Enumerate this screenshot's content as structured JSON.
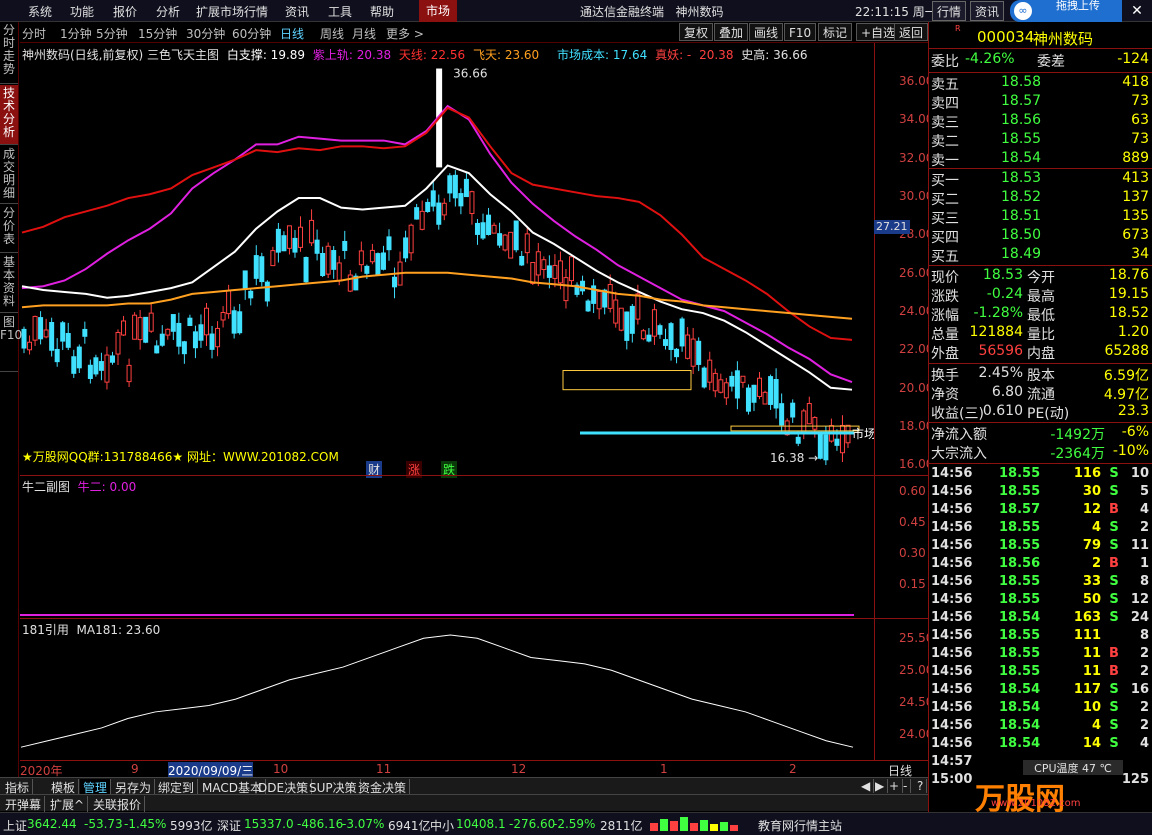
{
  "menu": [
    "系统",
    "功能",
    "报价",
    "分析",
    "扩展市场行情",
    "资讯",
    "工具",
    "帮助"
  ],
  "market_tab": "市场",
  "window_title": "通达信金融终端",
  "window_stock": "神州数码",
  "clock": "22:11:15 周一",
  "top_right_tabs": [
    "行情",
    "资讯"
  ],
  "upload_label": "拖拽上传",
  "left_tabs": [
    "分时走势",
    "技术分析",
    "成交明细",
    "分价表",
    "基本资料",
    "图F10"
  ],
  "periods": [
    "分时",
    "1分钟",
    "5分钟",
    "15分钟",
    "30分钟",
    "60分钟",
    "日线",
    "周线",
    "月线",
    "更多 >"
  ],
  "period_selected": "日线",
  "chart_buttons": [
    "复权",
    "叠加",
    "画线",
    "F10",
    "标记",
    "+自选",
    "返回"
  ],
  "legend": {
    "title": "神州数码(日线,前复权) 三色飞天主图",
    "white": "白支撑: 19.89",
    "purple": "紫上轨: 20.38",
    "red": "天线: 22.56",
    "fly": "飞天: 23.60",
    "cost": "市场成本: 17.64",
    "true": "真妖: -",
    "v2038": "20.38",
    "hist": "史高: 36.66"
  },
  "main_y": [
    "36.00",
    "34.00",
    "32.00",
    "30.00",
    "28.00",
    "26.00",
    "24.00",
    "22.00",
    "20.00",
    "18.00",
    "16.00"
  ],
  "price_tag": "27.21",
  "high_label": "36.66",
  "low_label": "16.38",
  "market_label": "市场",
  "ad_text": "★万股网QQ群:131788466★ 网址：WWW.201082.COM",
  "tags": [
    "财",
    "涨",
    "跌"
  ],
  "sub1": {
    "name": "牛二副图",
    "field": "牛二: 0.00",
    "y": [
      "0.60",
      "0.45",
      "0.30",
      "0.15"
    ]
  },
  "sub2": {
    "name": "181引用",
    "field": "MA181: 23.60",
    "y": [
      "25.50",
      "25.00",
      "24.50",
      "24.00"
    ]
  },
  "x_labels": [
    "2020年",
    "9",
    "2020/09/09/三",
    "10",
    "11",
    "12",
    "1",
    "2"
  ],
  "x_right": "日线",
  "bottom_tabs": [
    "指标",
    "模板",
    "管理",
    "另存为",
    "绑定到",
    "MACD基本",
    "DDE决策",
    "SUP决策",
    "资金决策"
  ],
  "bottom_sel": "管理",
  "bottom_tabs2": [
    "开弹幕",
    "扩展^",
    "关联报价"
  ],
  "status": {
    "sh_label": "上证",
    "sh_val": "3642.44",
    "sh_chg": "-53.73",
    "sh_pct": "-1.45%",
    "sh_amt": "5993亿",
    "sz_label": "深证",
    "sz_val": "15337.0",
    "sz_chg": "-486.16",
    "sz_pct": "-3.07%",
    "sz_amt": "6941亿",
    "zx_label": "中小",
    "zx_val": "10408.1",
    "zx_chg": "-276.60",
    "zx_pct": "-2.59%",
    "zx_amt": "2811亿",
    "site": "教育网行情主站"
  },
  "stock": {
    "code": "000034",
    "name": "神州数码"
  },
  "quote": {
    "weibi_label": "委比",
    "weibi": "-4.26%",
    "weicha_label": "委差",
    "weicha": "-124"
  },
  "asks": [
    {
      "l": "卖五",
      "p": "18.58",
      "v": "418"
    },
    {
      "l": "卖四",
      "p": "18.57",
      "v": "73"
    },
    {
      "l": "卖三",
      "p": "18.56",
      "v": "63"
    },
    {
      "l": "卖二",
      "p": "18.55",
      "v": "73"
    },
    {
      "l": "卖一",
      "p": "18.54",
      "v": "889"
    }
  ],
  "bids": [
    {
      "l": "买一",
      "p": "18.53",
      "v": "413"
    },
    {
      "l": "买二",
      "p": "18.52",
      "v": "137"
    },
    {
      "l": "买三",
      "p": "18.51",
      "v": "135"
    },
    {
      "l": "买四",
      "p": "18.50",
      "v": "673"
    },
    {
      "l": "买五",
      "p": "18.49",
      "v": "34"
    }
  ],
  "stats1": [
    {
      "l": "现价",
      "v": "18.53",
      "c": "down",
      "l2": "今开",
      "v2": "18.76",
      "c2": "up"
    },
    {
      "l": "涨跌",
      "v": "-0.24",
      "c": "down",
      "l2": "最高",
      "v2": "19.15",
      "c2": "up"
    },
    {
      "l": "涨幅",
      "v": "-1.28%",
      "c": "down",
      "l2": "最低",
      "v2": "18.52",
      "c2": "down"
    },
    {
      "l": "总量",
      "v": "121884",
      "c": "yellow",
      "l2": "量比",
      "v2": "1.20",
      "c2": "up"
    },
    {
      "l": "外盘",
      "v": "56596",
      "c": "up",
      "l2": "内盘",
      "v2": "65288",
      "c2": "down"
    }
  ],
  "stats2": [
    {
      "l": "换手",
      "v": "2.45%",
      "l2": "股本",
      "v2": "6.59亿"
    },
    {
      "l": "净资",
      "v": "6.80",
      "l2": "流通",
      "v2": "4.97亿"
    },
    {
      "l": "收益(三)",
      "v": "0.610",
      "l2": "PE(动)",
      "v2": "23.3"
    }
  ],
  "flow": [
    {
      "l": "净流入额",
      "v": "-1492万",
      "p": "-6%"
    },
    {
      "l": "大宗流入",
      "v": "-2364万",
      "p": "-10%"
    }
  ],
  "ticks": [
    {
      "t": "14:56",
      "p": "18.55",
      "v": "116",
      "d": "S",
      "n": "10"
    },
    {
      "t": "14:56",
      "p": "18.55",
      "v": "30",
      "d": "S",
      "n": "5"
    },
    {
      "t": "14:56",
      "p": "18.57",
      "v": "12",
      "d": "B",
      "n": "4"
    },
    {
      "t": "14:56",
      "p": "18.55",
      "v": "4",
      "d": "S",
      "n": "2"
    },
    {
      "t": "14:56",
      "p": "18.55",
      "v": "79",
      "d": "S",
      "n": "11"
    },
    {
      "t": "14:56",
      "p": "18.56",
      "v": "2",
      "d": "B",
      "n": "1"
    },
    {
      "t": "14:56",
      "p": "18.55",
      "v": "33",
      "d": "S",
      "n": "8"
    },
    {
      "t": "14:56",
      "p": "18.55",
      "v": "50",
      "d": "S",
      "n": "12"
    },
    {
      "t": "14:56",
      "p": "18.54",
      "v": "163",
      "d": "S",
      "n": "24"
    },
    {
      "t": "14:56",
      "p": "18.55",
      "v": "111",
      "d": "",
      "n": "8"
    },
    {
      "t": "14:56",
      "p": "18.55",
      "v": "11",
      "d": "B",
      "n": "2"
    },
    {
      "t": "14:56",
      "p": "18.55",
      "v": "11",
      "d": "B",
      "n": "2"
    },
    {
      "t": "14:56",
      "p": "18.54",
      "v": "117",
      "d": "S",
      "n": "16"
    },
    {
      "t": "14:56",
      "p": "18.54",
      "v": "10",
      "d": "S",
      "n": "2"
    },
    {
      "t": "14:56",
      "p": "18.54",
      "v": "4",
      "d": "S",
      "n": "2"
    },
    {
      "t": "14:56",
      "p": "18.54",
      "v": "14",
      "d": "S",
      "n": "4"
    },
    {
      "t": "14:57",
      "p": "",
      "v": "",
      "d": "",
      "n": ""
    },
    {
      "t": "15:00",
      "p": "",
      "v": "",
      "d": "",
      "n": "125"
    }
  ],
  "cpu_label": "CPU温度 47 ℃",
  "watermark": "万股网",
  "watermark_url": "www.201082.com",
  "chart_data": {
    "type": "line",
    "series": [
      {
        "name": "紫上轨",
        "color": "#e020e0",
        "values": [
          25.2,
          25.3,
          25.6,
          26.2,
          27.0,
          27.7,
          28.3,
          29.1,
          30.4,
          31.2,
          31.9,
          32.7,
          32.7,
          33.1,
          33.0,
          32.9,
          32.9,
          32.9,
          32.7,
          33.4,
          34.7,
          34.0,
          32.2,
          30.7,
          29.6,
          28.7,
          27.9,
          27.2,
          26.4,
          25.8,
          25.2,
          24.6,
          24.3,
          24.0,
          23.4,
          22.8,
          22.1,
          21.5,
          20.7,
          20.3
        ]
      },
      {
        "name": "天线",
        "color": "#e01010",
        "values": [
          28.1,
          28.4,
          28.9,
          29.2,
          29.5,
          29.9,
          30.1,
          30.4,
          31.1,
          31.5,
          31.9,
          32.4,
          32.3,
          32.5,
          32.4,
          32.6,
          32.6,
          32.5,
          32.6,
          33.3,
          34.6,
          34.1,
          32.6,
          31.2,
          30.6,
          30.4,
          30.2,
          30.0,
          29.9,
          29.7,
          29.0,
          28.0,
          26.8,
          26.2,
          25.6,
          24.9,
          24.0,
          23.2,
          22.6,
          22.5
        ]
      },
      {
        "name": "白支撑",
        "color": "#ffffff",
        "values": [
          25.3,
          25.1,
          25.0,
          24.9,
          24.7,
          24.8,
          25.0,
          25.2,
          25.5,
          26.3,
          27.1,
          28.3,
          29.2,
          29.9,
          29.9,
          29.4,
          29.3,
          29.4,
          29.5,
          30.4,
          31.6,
          31.2,
          30.1,
          29.2,
          28.1,
          27.5,
          26.8,
          26.1,
          25.5,
          25.0,
          24.5,
          24.1,
          23.9,
          23.5,
          22.9,
          22.2,
          21.5,
          20.8,
          20.0,
          19.9
        ]
      },
      {
        "name": "飞天",
        "color": "#ffa020",
        "values": [
          24.2,
          24.3,
          24.3,
          24.3,
          24.3,
          24.4,
          24.4,
          24.6,
          24.9,
          25.0,
          25.1,
          25.2,
          25.3,
          25.4,
          25.5,
          25.6,
          25.8,
          25.9,
          26.0,
          26.0,
          26.0,
          25.9,
          25.8,
          25.7,
          25.5,
          25.4,
          25.3,
          25.1,
          24.9,
          24.8,
          24.6,
          24.5,
          24.3,
          24.2,
          24.1,
          24.0,
          23.9,
          23.8,
          23.7,
          23.6
        ]
      }
    ],
    "ma181": [
      23.8,
      23.9,
      24.0,
      24.1,
      24.25,
      24.35,
      24.4,
      24.45,
      24.55,
      24.7,
      24.85,
      24.95,
      25.05,
      25.2,
      25.35,
      25.5,
      25.55,
      25.5,
      25.35,
      25.2,
      25.15,
      25.1,
      25.0,
      24.85,
      24.7,
      24.55,
      24.45,
      24.35,
      24.2,
      24.05,
      23.9,
      23.8
    ],
    "y_main_range": [
      15.5,
      37.0
    ],
    "y_ma_range": [
      23.6,
      25.8
    ]
  }
}
